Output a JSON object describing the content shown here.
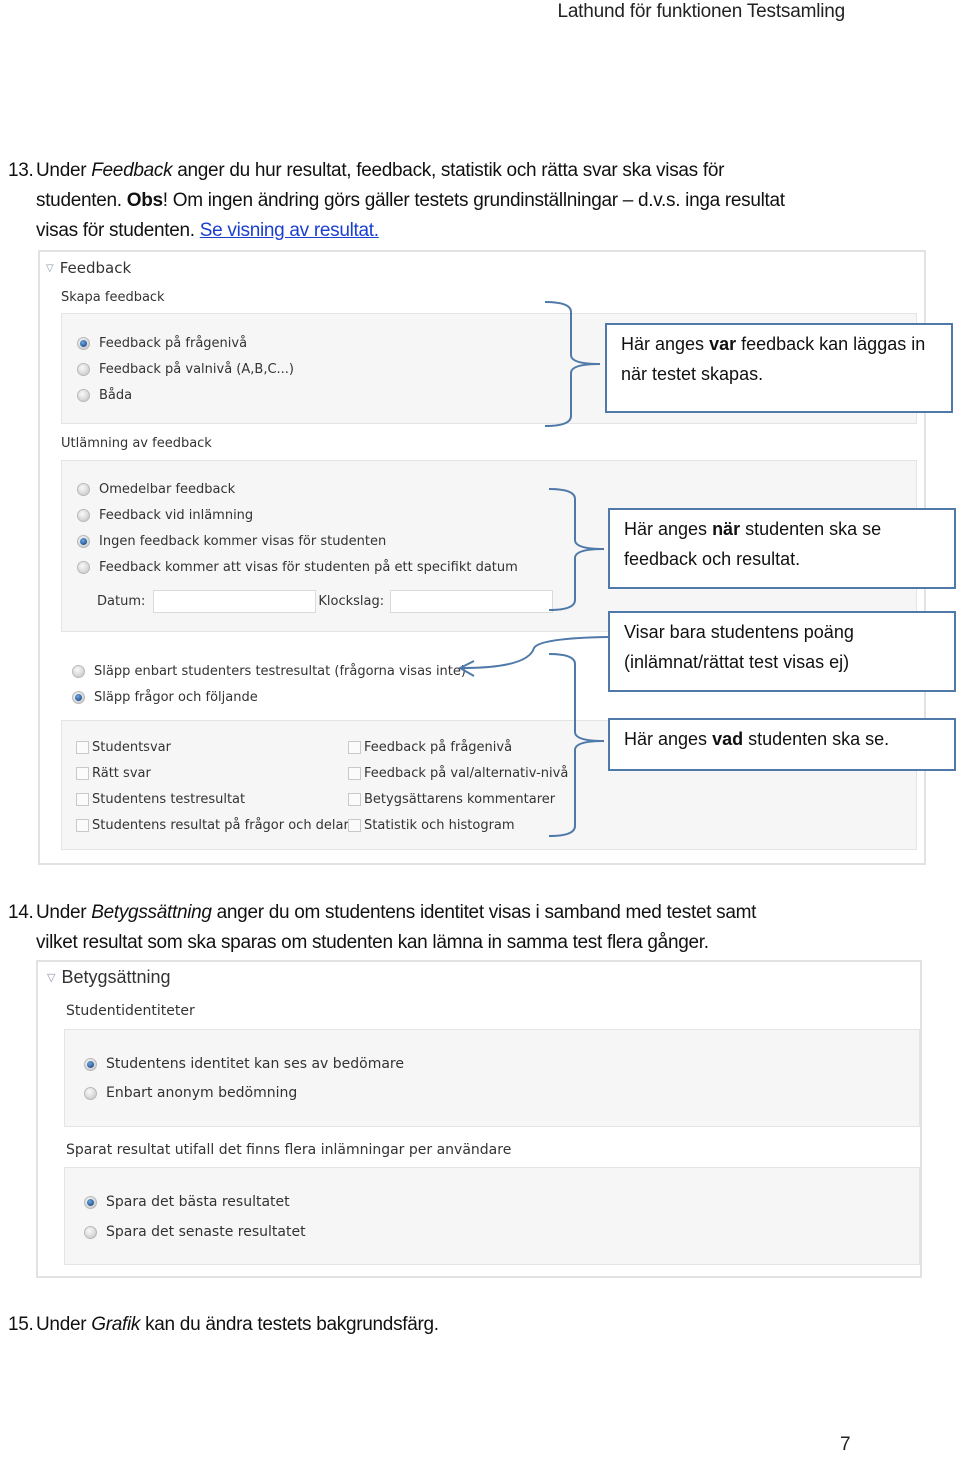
{
  "header": {
    "title": "Lathund för funktionen Testsamling"
  },
  "step13": {
    "number": "13.",
    "line1_pre": "Under ",
    "line1_em": "Feedback",
    "line1_post": " anger du hur resultat, feedback, statistik och rätta svar ska visas för",
    "line2_pre": "studenten. ",
    "line2_bold": "Obs",
    "line2_post": "! Om ingen ändring görs gäller testets grundinställningar – d.v.s. inga resultat",
    "line3_pre": "visas för studenten. ",
    "link": "Se visning av resultat."
  },
  "feedback_panel": {
    "title": "Feedback",
    "skapa": {
      "label": "Skapa feedback",
      "options": [
        {
          "label": "Feedback på frågenivå",
          "selected": true
        },
        {
          "label": "Feedback på valnivå (A,B,C...)",
          "selected": false
        },
        {
          "label": "Båda",
          "selected": false
        }
      ]
    },
    "utlamning": {
      "label": "Utlämning av feedback",
      "options": [
        {
          "label": "Omedelbar feedback",
          "selected": false
        },
        {
          "label": "Feedback vid inlämning",
          "selected": false
        },
        {
          "label": "Ingen feedback kommer visas för studenten",
          "selected": true
        },
        {
          "label": "Feedback kommer att visas för studenten på ett specifikt datum",
          "selected": false
        }
      ],
      "date_label": "Datum:",
      "date_value": "",
      "time_label": "Klockslag:",
      "time_value": ""
    },
    "release": {
      "options": [
        {
          "label": "Släpp enbart studenters testresultat (frågorna visas inte)",
          "selected": false
        },
        {
          "label": "Släpp frågor och följande",
          "selected": true
        }
      ]
    },
    "checkboxes": {
      "left": [
        {
          "label": "Studentsvar",
          "checked": false
        },
        {
          "label": "Rätt svar",
          "checked": false
        },
        {
          "label": "Studentens testresultat",
          "checked": false
        },
        {
          "label": "Studentens resultat på frågor och delar",
          "checked": false
        }
      ],
      "right": [
        {
          "label": "Feedback på frågenivå",
          "checked": false
        },
        {
          "label": "Feedback på val/alternativ-nivå",
          "checked": false
        },
        {
          "label": "Betygsättarens kommentarer",
          "checked": false
        },
        {
          "label": "Statistik och histogram",
          "checked": false
        }
      ]
    }
  },
  "callouts": {
    "var": {
      "pre": "Här anges ",
      "bold": "var",
      "post": " feedback kan läggas in när testet skapas."
    },
    "nar": {
      "pre": "Här anges ",
      "bold": "när",
      "post": " studenten ska se feedback och resultat."
    },
    "poang": {
      "text": "Visar bara studentens poäng (inlämnat/rättat test visas ej)"
    },
    "vad": {
      "pre": "Här anges ",
      "bold": "vad",
      "post": " studenten ska se."
    }
  },
  "step14": {
    "number": "14.",
    "line1_pre": "Under ",
    "line1_em": "Betygssättning",
    "line1_post": " anger du om studentens identitet visas i samband med testet samt",
    "line2": "vilket resultat som ska sparas om studenten kan lämna in samma test flera gånger."
  },
  "betyg_panel": {
    "title": "Betygsättning",
    "identity": {
      "label": "Studentidentiteter",
      "options": [
        {
          "label": "Studentens identitet kan ses av bedömare",
          "selected": true
        },
        {
          "label": "Enbart anonym bedömning",
          "selected": false
        }
      ]
    },
    "saved": {
      "label": "Sparat resultat utifall det finns flera inlämningar per användare",
      "options": [
        {
          "label": "Spara det bästa resultatet",
          "selected": true
        },
        {
          "label": "Spara det senaste resultatet",
          "selected": false
        }
      ]
    }
  },
  "step15": {
    "number": "15.",
    "pre": "Under ",
    "em": "Grafik",
    "post": " kan du ändra testets bakgrundsfärg."
  },
  "footer": {
    "page_number": "7"
  },
  "colors": {
    "callout_border": "#4f79a9",
    "link": "#1a3fd0",
    "radio_selected": "#1e4f8c"
  }
}
